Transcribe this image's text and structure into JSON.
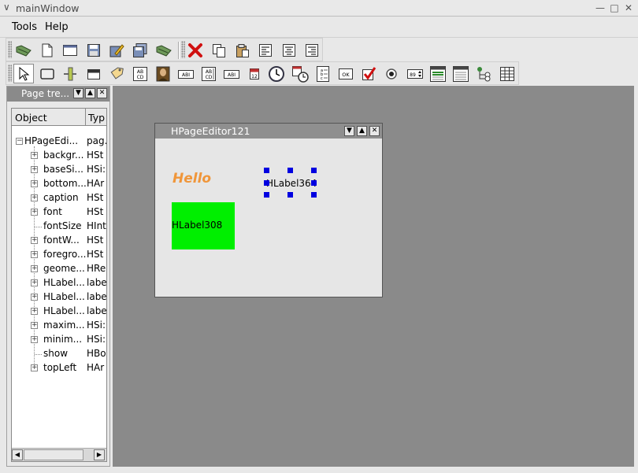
{
  "window": {
    "title": "mainWindow"
  },
  "menu": {
    "items": [
      "Tools",
      "Help"
    ]
  },
  "toolbar1": {
    "buttons": [
      "open-folder-icon",
      "new-document-icon",
      "window-icon",
      "save-icon",
      "edit-icon",
      "save-all-icon",
      "open-icon",
      "delete-icon",
      "copy-icon",
      "paste-icon",
      "align-left-icon",
      "align-center-icon",
      "align-right-icon"
    ]
  },
  "toolbar2": {
    "buttons": [
      "pointer-icon",
      "frame-icon",
      "slider-icon",
      "panel-icon",
      "tag-icon",
      "text-icon",
      "image-icon",
      "label-icon",
      "text-edit-icon",
      "line-edit-icon",
      "calendar-icon",
      "clock-icon",
      "date-time-icon",
      "list-icon",
      "ok-button-icon",
      "checkbox-icon",
      "radio-icon",
      "spinbox-icon",
      "combo-icon",
      "combo-list-icon",
      "tree-icon",
      "table-icon"
    ],
    "ok_text": "OK",
    "spin_text": "89"
  },
  "dock": {
    "title": "Page tre...",
    "columns": {
      "object": "Object",
      "type": "Typ"
    },
    "root": {
      "object": "HPageEdi...",
      "type": "pag."
    },
    "rows": [
      {
        "object": "backgr...",
        "type": "HSt",
        "expandable": true
      },
      {
        "object": "baseSi...",
        "type": "HSi:",
        "expandable": true
      },
      {
        "object": "bottom...",
        "type": "HAr",
        "expandable": true
      },
      {
        "object": "caption",
        "type": "HSt",
        "expandable": true
      },
      {
        "object": "font",
        "type": "HSt",
        "expandable": true
      },
      {
        "object": "fontSize",
        "type": "HInt",
        "expandable": false
      },
      {
        "object": "fontW...",
        "type": "HSt",
        "expandable": true
      },
      {
        "object": "foregro...",
        "type": "HSt",
        "expandable": true
      },
      {
        "object": "geome...",
        "type": "HRe",
        "expandable": true
      },
      {
        "object": "HLabel...",
        "type": "labe",
        "expandable": true
      },
      {
        "object": "HLabel...",
        "type": "labe",
        "expandable": true
      },
      {
        "object": "HLabel...",
        "type": "labe",
        "expandable": true
      },
      {
        "object": "maxim...",
        "type": "HSi:",
        "expandable": true
      },
      {
        "object": "minim...",
        "type": "HSi:",
        "expandable": true
      },
      {
        "object": "show",
        "type": "HBo",
        "expandable": false
      },
      {
        "object": "topLeft",
        "type": "HAr",
        "expandable": true
      }
    ]
  },
  "editor": {
    "title": "HPageEditor121",
    "hello_text": "Hello",
    "green_label": "HLabel308",
    "selected_label": "HLabel364",
    "colors": {
      "hello": "#f0963a",
      "green": "#00ef00",
      "handle": "#0000e0"
    }
  }
}
